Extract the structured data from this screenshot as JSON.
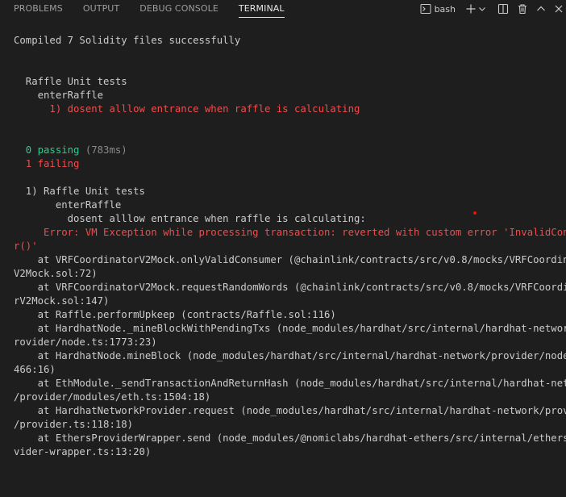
{
  "tabs": [
    {
      "label": "PROBLEMS"
    },
    {
      "label": "OUTPUT"
    },
    {
      "label": "DEBUG CONSOLE"
    },
    {
      "label": "TERMINAL",
      "active": true
    }
  ],
  "header_actions": {
    "shell_name": "bash",
    "icons": [
      "terminal-icon",
      "plus-icon",
      "chevron-down-icon",
      "split-icon",
      "trash-icon",
      "chevron-up-icon",
      "close-icon"
    ]
  },
  "terminal": {
    "lines": [
      {
        "text": "Compiled 7 Solidity files successfully",
        "color": "white"
      },
      {
        "text": "",
        "color": "white"
      },
      {
        "text": "",
        "color": "white"
      },
      {
        "text": "  Raffle Unit tests",
        "color": "white"
      },
      {
        "text": "    enterRaffle",
        "color": "white"
      },
      {
        "text": "      1) dosent alllow entrance when raffle is calculating",
        "color": "red"
      },
      {
        "text": "",
        "color": "white"
      },
      {
        "text": "",
        "color": "white"
      },
      {
        "text": "  0 passing",
        "color": "green",
        "suffix": " (783ms)",
        "suffix_color": "gray"
      },
      {
        "text": "  1 failing",
        "color": "red"
      },
      {
        "text": "",
        "color": "white"
      },
      {
        "text": "  1) Raffle Unit tests",
        "color": "white"
      },
      {
        "text": "       enterRaffle",
        "color": "white"
      },
      {
        "text": "         dosent alllow entrance when raffle is calculating:",
        "color": "white"
      },
      {
        "text": "     Error: VM Exception while processing transaction: reverted with custom error 'InvalidConsume",
        "color": "red"
      },
      {
        "text": "r()'",
        "color": "red"
      },
      {
        "text": "    at VRFCoordinatorV2Mock.onlyValidConsumer (@chainlink/contracts/src/v0.8/mocks/VRFCoordinator",
        "color": "white"
      },
      {
        "text": "V2Mock.sol:72)",
        "color": "white"
      },
      {
        "text": "    at VRFCoordinatorV2Mock.requestRandomWords (@chainlink/contracts/src/v0.8/mocks/VRFCoordinato",
        "color": "white"
      },
      {
        "text": "rV2Mock.sol:147)",
        "color": "white"
      },
      {
        "text": "    at Raffle.performUpkeep (contracts/Raffle.sol:116)",
        "color": "white"
      },
      {
        "text": "    at HardhatNode._mineBlockWithPendingTxs (node_modules/hardhat/src/internal/hardhat-network/p",
        "color": "white"
      },
      {
        "text": "rovider/node.ts:1773:23)",
        "color": "white"
      },
      {
        "text": "    at HardhatNode.mineBlock (node_modules/hardhat/src/internal/hardhat-network/provider/node.ts:",
        "color": "white"
      },
      {
        "text": "466:16)",
        "color": "white"
      },
      {
        "text": "    at EthModule._sendTransactionAndReturnHash (node_modules/hardhat/src/internal/hardhat-network",
        "color": "white"
      },
      {
        "text": "/provider/modules/eth.ts:1504:18)",
        "color": "white"
      },
      {
        "text": "    at HardhatNetworkProvider.request (node_modules/hardhat/src/internal/hardhat-network/provider",
        "color": "white"
      },
      {
        "text": "/provider.ts:118:18)",
        "color": "white"
      },
      {
        "text": "    at EthersProviderWrapper.send (node_modules/@nomiclabs/hardhat-ethers/src/internal/ethers-pro",
        "color": "white"
      },
      {
        "text": "vider-wrapper.ts:13:20)",
        "color": "white"
      }
    ]
  },
  "colors": {
    "background": "#1e1e1e",
    "text": "#cccccc",
    "error": "#f14c4c",
    "success": "#23d18b",
    "muted": "#8a8a8a",
    "active_tab": "#e7e7e7"
  }
}
